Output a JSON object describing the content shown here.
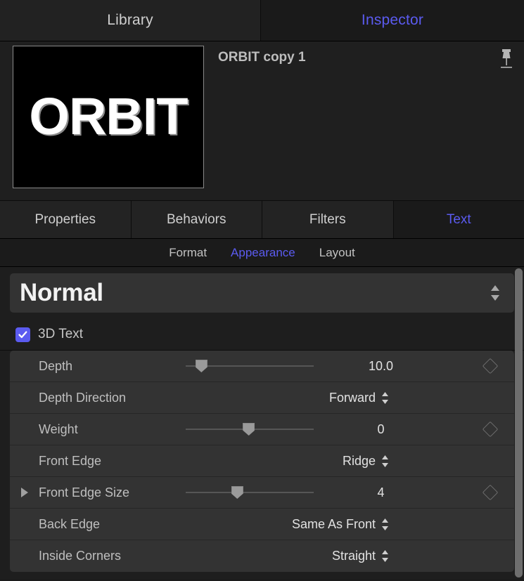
{
  "top_tabs": [
    {
      "label": "Library",
      "active": false
    },
    {
      "label": "Inspector",
      "active": true
    }
  ],
  "preview": {
    "object_title": "ORBIT copy 1",
    "thumbnail_text": "ORBIT",
    "pin_icon": "pushpin-icon"
  },
  "sub_tabs": [
    {
      "label": "Properties",
      "active": false
    },
    {
      "label": "Behaviors",
      "active": false
    },
    {
      "label": "Filters",
      "active": false
    },
    {
      "label": "Text",
      "active": true
    }
  ],
  "sub_sub_tabs": [
    {
      "label": "Format",
      "active": false
    },
    {
      "label": "Appearance",
      "active": true
    },
    {
      "label": "Layout",
      "active": false
    }
  ],
  "blend_mode": {
    "value": "Normal",
    "stepper_icon": "stepper-up-down-icon"
  },
  "three_d_text": {
    "label": "3D Text",
    "checked": true,
    "check_icon": "checkmark-icon"
  },
  "parameters": [
    {
      "name": "Depth",
      "kind": "slider",
      "value": "10.0",
      "slider_percent": 12,
      "has_keyframe": true,
      "has_disclosure": false
    },
    {
      "name": "Depth Direction",
      "kind": "popup",
      "value": "Forward",
      "has_keyframe": false,
      "has_disclosure": false
    },
    {
      "name": "Weight",
      "kind": "slider",
      "value": "0",
      "slider_percent": 49,
      "has_keyframe": true,
      "has_disclosure": false
    },
    {
      "name": "Front Edge",
      "kind": "popup",
      "value": "Ridge",
      "has_keyframe": false,
      "has_disclosure": false
    },
    {
      "name": "Front Edge Size",
      "kind": "slider",
      "value": "4",
      "slider_percent": 40,
      "has_keyframe": true,
      "has_disclosure": true
    },
    {
      "name": "Back Edge",
      "kind": "popup",
      "value": "Same As Front",
      "has_keyframe": false,
      "has_disclosure": false
    },
    {
      "name": "Inside Corners",
      "kind": "popup",
      "value": "Straight",
      "has_keyframe": false,
      "has_disclosure": false
    }
  ],
  "colors": {
    "accent": "#5b5bf0",
    "row_bg": "#333333",
    "panel_bg": "#1e1e1e"
  }
}
